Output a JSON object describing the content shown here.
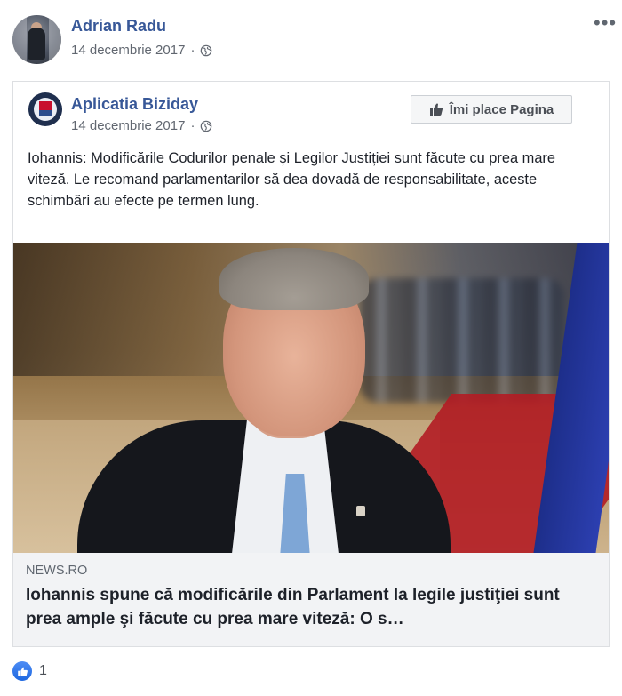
{
  "post": {
    "author_name": "Adrian Radu",
    "date": "14 decembrie 2017",
    "separator": "·",
    "more_label": "•••"
  },
  "shared": {
    "page_name": "Aplicatia Biziday",
    "date": "14 decembrie 2017",
    "separator": "·",
    "like_page_label": "Îmi place Pagina",
    "text": "Iohannis: Modificările Codurilor penale și Legilor Justiției sunt făcute cu prea mare viteză. Le recomand parlamentarilor să dea dovadă de responsabilitate, aceste schimbări au efecte pe termen lung.",
    "link": {
      "domain": "NEWS.RO",
      "title": "Iohannis spune că modificările din Parlament la legile justiţiei sunt prea ample şi făcute cu prea mare viteză: O s…"
    }
  },
  "reactions": {
    "count": "1",
    "icon": "like-icon"
  },
  "colors": {
    "link_blue": "#385898",
    "meta_gray": "#616770",
    "card_bg": "#f2f3f5",
    "like_blue": "#1d67e0"
  }
}
